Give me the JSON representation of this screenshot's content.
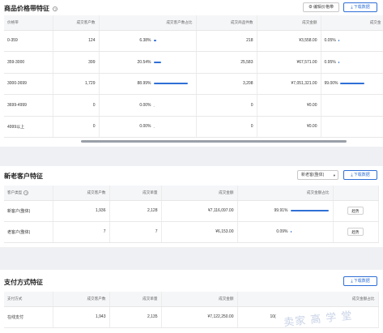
{
  "price_section": {
    "title": "商品价格带特征",
    "edit_button": "编辑价格带",
    "download_button": "下载数据",
    "columns": [
      "价格带",
      "成交客户数",
      "成交客户数占比",
      "成交商品件数",
      "成交金额",
      "成交金"
    ],
    "rows": [
      {
        "band": "0-359",
        "customers": "124",
        "pct": "6.38%",
        "pct_value": 0.0638,
        "items": "218",
        "amount": "¥3,558.00",
        "more": "0.05%"
      },
      {
        "band": "359-3000",
        "customers": "399",
        "pct": "20.54%",
        "pct_value": 0.2054,
        "items": "25,583",
        "amount": "¥67,571.00",
        "more": "0.95%"
      },
      {
        "band": "3000-3699",
        "customers": "1,729",
        "pct": "88.99%",
        "pct_value": 0.8899,
        "items": "3,208",
        "amount": "¥7,051,321.00",
        "more": "99.00%"
      },
      {
        "band": "3699-4999",
        "customers": "0",
        "pct": "0.00%",
        "pct_value": 0,
        "items": "0",
        "amount": "¥0.00",
        "more": ""
      },
      {
        "band": "4999以上",
        "customers": "0",
        "pct": "0.00%",
        "pct_value": 0,
        "items": "0",
        "amount": "¥0.00",
        "more": ""
      }
    ]
  },
  "customer_section": {
    "title": "新老客户特征",
    "filter_select": "新老客(整体)",
    "download_button": "下载数据",
    "columns": [
      "客户类型",
      "成交客户数",
      "成交单量",
      "成交金额",
      "成交金额占比",
      ""
    ],
    "rows": [
      {
        "type": "新客户(整体)",
        "customers": "1,936",
        "orders": "2,128",
        "amount": "¥7,116,097.00",
        "pct": "99.91%",
        "pct_value": 0.9991,
        "action": "趋势"
      },
      {
        "type": "老客户(整体)",
        "customers": "7",
        "orders": "7",
        "amount": "¥6,153.00",
        "pct": "0.09%",
        "pct_value": 0.0009,
        "action": "趋势"
      }
    ]
  },
  "payment_section": {
    "title": "支付方式特征",
    "download_button": "下载数据",
    "columns": [
      "支付方式",
      "成交客户数",
      "成交单量",
      "成交金额",
      "成交金额占比"
    ],
    "rows": [
      {
        "method": "在线支付",
        "customers": "1,943",
        "orders": "2,135",
        "amount": "¥7,122,250.00",
        "pct": "10("
      }
    ]
  },
  "watermark": "卖家 高 学 堂",
  "colors": {
    "accent": "#2f6fd6",
    "header_bg": "#f5f6f8",
    "page_bg": "#eef0f3"
  }
}
